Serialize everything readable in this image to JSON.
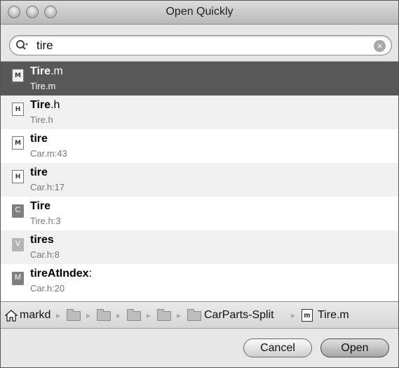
{
  "window": {
    "title": "Open Quickly"
  },
  "search": {
    "value": "tire",
    "icon": "search-icon",
    "clear_icon": "clear-icon"
  },
  "results": [
    {
      "match": "Tire",
      "rest": ".m",
      "path": "Tire.m",
      "icon": "M",
      "icon_type": "doc"
    },
    {
      "match": "Tire",
      "rest": ".h",
      "path": "Tire.h",
      "icon": "H",
      "icon_type": "doc"
    },
    {
      "match": "tire",
      "rest": "",
      "path": "Car.m:43",
      "icon": "M",
      "icon_type": "doc"
    },
    {
      "match": "tire",
      "rest": "",
      "path": "Car.h:17",
      "icon": "H",
      "icon_type": "doc"
    },
    {
      "match": "Tire",
      "rest": "",
      "path": "Tire.h:3",
      "icon": "C",
      "icon_type": "symbol"
    },
    {
      "match": "tires",
      "rest": "",
      "path": "Car.h:8",
      "icon": "V",
      "icon_type": "symbol-light"
    },
    {
      "match": "tireAtIndex",
      "rest": ":",
      "path": "Car.h:20",
      "icon": "M",
      "icon_type": "symbol"
    }
  ],
  "pathbar": {
    "home": "markd",
    "project": "CarParts-Split",
    "file": "Tire.m",
    "file_icon": "m"
  },
  "buttons": {
    "cancel": "Cancel",
    "open": "Open"
  }
}
